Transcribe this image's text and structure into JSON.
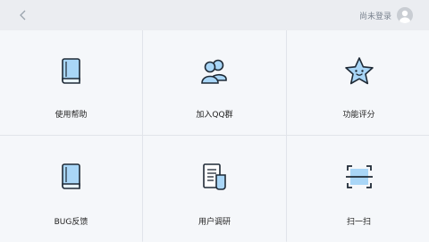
{
  "header": {
    "login_text": "尚未登录"
  },
  "tiles": [
    {
      "label": "使用帮助",
      "icon": "book-icon"
    },
    {
      "label": "加入QQ群",
      "icon": "users-icon"
    },
    {
      "label": "功能评分",
      "icon": "star-face-icon"
    },
    {
      "label": "BUG反馈",
      "icon": "book-icon"
    },
    {
      "label": "用户调研",
      "icon": "document-icon"
    },
    {
      "label": "扫一扫",
      "icon": "scan-icon"
    }
  ],
  "colors": {
    "icon_fill": "#a9d6f7",
    "icon_stroke": "#1f2a36",
    "background": "#f5f7fa"
  }
}
